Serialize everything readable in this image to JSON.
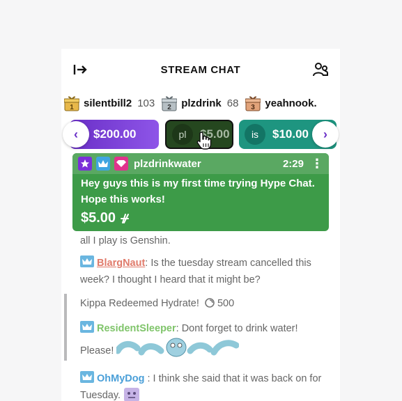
{
  "header": {
    "title": "STREAM CHAT"
  },
  "leaderboard": [
    {
      "rank": "1",
      "name": "silentbill2",
      "count": "103",
      "color": "#e8b84a"
    },
    {
      "rank": "2",
      "name": "plzdrink",
      "count": "68",
      "color": "#9aa6ad"
    },
    {
      "rank": "3",
      "name": "yeahnook.",
      "count": "",
      "color": "#d99a6c"
    }
  ],
  "carousel": [
    {
      "avatar": "n",
      "amount": "$200.00",
      "color": "#6a2fc7"
    },
    {
      "avatar": "pl",
      "amount": "$5.00",
      "color": "#25471f"
    },
    {
      "avatar": "is",
      "amount": "$10.00",
      "color": "#1e9580"
    }
  ],
  "hype_chat": {
    "user": "plzdrinkwater",
    "time": "2:29",
    "message": "Hey guys this is my first time trying Hype Chat. Hope this works!",
    "amount": "$5.00",
    "color": "#3d9b48"
  },
  "messages": {
    "m0": {
      "text": "all I play is Genshin."
    },
    "m1": {
      "user": "BlargNaut",
      "sep": ":",
      "text": " Is the tuesday stream cancelled this week? I thought I heard that it might be?",
      "color": "#e07a6a"
    },
    "m2": {
      "text": "Kippa Redeemed Hydrate!",
      "points": "500"
    },
    "m3": {
      "user": "ResidentSleeper",
      "sep": ":",
      "text": " Dont forget to drink water! Please!",
      "color": "#7fc46a"
    },
    "m4": {
      "user": "OhMyDog",
      "sep": " :",
      "text": " I think she said that it was back on for Tuesday.",
      "color": "#4a9fd8"
    }
  }
}
